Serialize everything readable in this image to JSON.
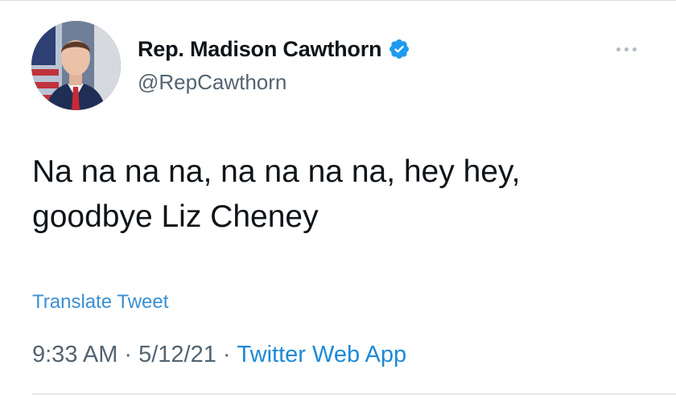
{
  "tweet": {
    "author": {
      "display_name": "Rep. Madison Cawthorn",
      "handle": "@RepCawthorn",
      "verified": true,
      "avatar_icon": "profile-photo"
    },
    "more_icon": "more-horizontal-icon",
    "text_lines": [
      "Na na na na, na na na na, hey hey,",
      "goodbye Liz Cheney"
    ],
    "translate_label": "Translate Tweet",
    "meta": {
      "time": "9:33 AM",
      "separator": "·",
      "date": "5/12/21",
      "source": "Twitter Web App"
    }
  },
  "colors": {
    "verified_blue": "#1d9bf0",
    "link_blue": "#3b8fd1",
    "secondary_text": "#536471"
  }
}
